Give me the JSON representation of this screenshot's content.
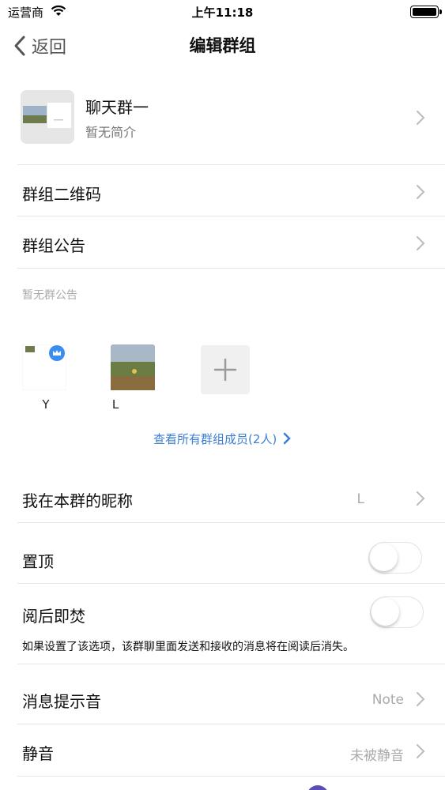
{
  "status_bar": {
    "carrier": "运营商",
    "time": "上午11:18"
  },
  "nav": {
    "back_label": "返回",
    "title": "编辑群组"
  },
  "group": {
    "name": "聊天群一",
    "description": "暂无简介"
  },
  "rows": {
    "qr_code": "群组二维码",
    "announcement": "群组公告",
    "announcement_text": "暂无群公告",
    "nickname_label": "我在本群的昵称",
    "nickname_value": "L",
    "pin_label": "置顶",
    "burn_label": "阅后即焚",
    "burn_desc": "如果设置了该选项，该群聊里面发送和接收的消息将在阅读后消失。",
    "sound_label": "消息提示音",
    "sound_value": "Note",
    "mute_label": "静音",
    "mute_value": "未被静音"
  },
  "members": [
    {
      "name": "Y",
      "is_owner": true
    },
    {
      "name": "L",
      "is_owner": false
    }
  ],
  "view_all": "查看所有群组成员(2人)",
  "toggles": {
    "pin": false,
    "burn_after_reading": false
  },
  "colors": {
    "link": "#3b7fd6",
    "owner_badge": "#3b8df0"
  }
}
